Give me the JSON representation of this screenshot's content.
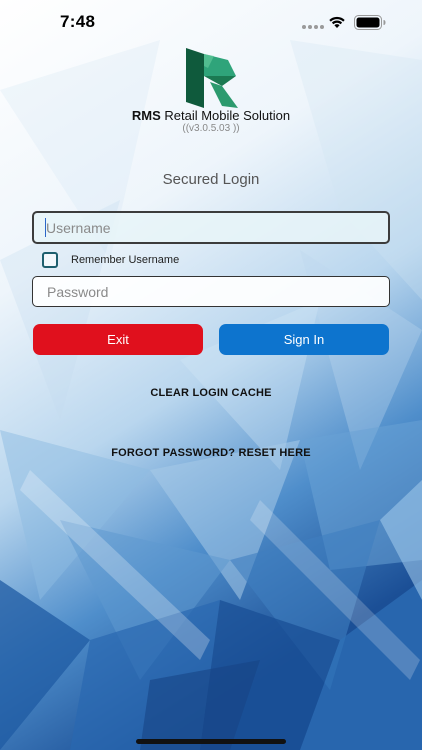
{
  "status_bar": {
    "time": "7:48"
  },
  "header": {
    "brand": "RMS",
    "title_rest": " Retail Mobile Solution",
    "version": "((v3.0.5.03 ))"
  },
  "login": {
    "heading": "Secured Login",
    "username_placeholder": "Username",
    "remember_label": "Remember Username",
    "remember_checked": false,
    "password_placeholder": "Password",
    "exit_label": "Exit",
    "signin_label": "Sign In",
    "clear_cache_label": "CLEAR LOGIN CACHE",
    "forgot_label": "FORGOT PASSWORD? RESET HERE"
  },
  "colors": {
    "exit_button": "#e0101d",
    "signin_button": "#0d74ce",
    "logo_green_dark": "#0f5a3c",
    "logo_green_light": "#2fa47a",
    "background_blue": "#1f5ea8"
  },
  "icons": [
    "wifi-icon",
    "battery-icon",
    "rms-logo"
  ]
}
